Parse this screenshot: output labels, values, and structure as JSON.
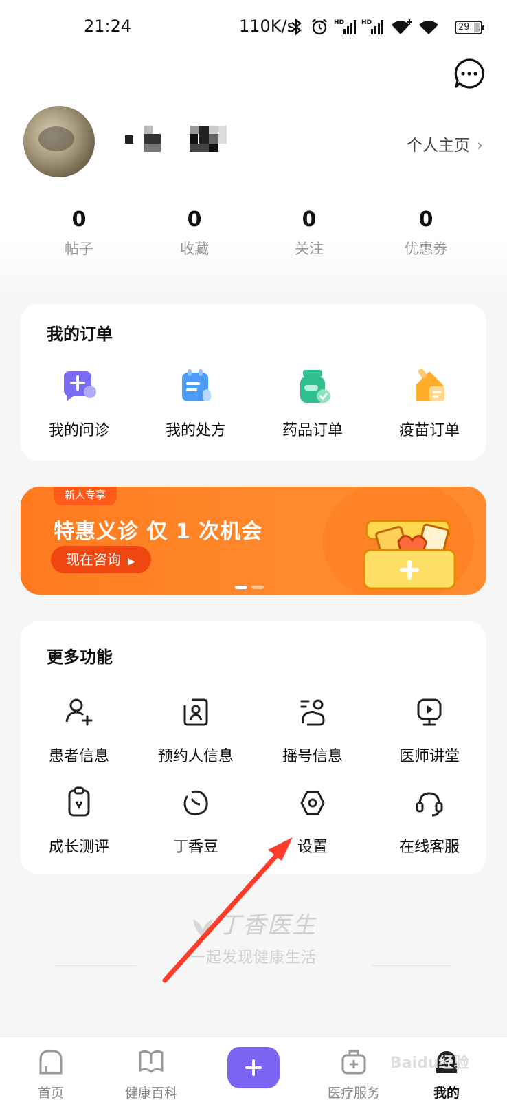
{
  "status_bar": {
    "time": "21:24",
    "speed": "110K/s",
    "battery": "29"
  },
  "profile": {
    "home_link": "个人主页",
    "stats": [
      {
        "value": "0",
        "label": "帖子"
      },
      {
        "value": "0",
        "label": "收藏"
      },
      {
        "value": "0",
        "label": "关注"
      },
      {
        "value": "0",
        "label": "优惠券"
      }
    ]
  },
  "orders": {
    "title": "我的订单",
    "items": [
      {
        "label": "我的问诊",
        "icon": "consult-icon",
        "color": "#7b6cf6"
      },
      {
        "label": "我的处方",
        "icon": "prescription-icon",
        "color": "#4d9bf8"
      },
      {
        "label": "药品订单",
        "icon": "medicine-icon",
        "color": "#2fbf8c"
      },
      {
        "label": "疫苗订单",
        "icon": "vaccine-icon",
        "color": "#ffad2a"
      }
    ]
  },
  "banner": {
    "badge": "新人专享",
    "title": "特惠义诊 仅 1 次机会",
    "cta": "现在咨询"
  },
  "more": {
    "title": "更多功能",
    "items": [
      {
        "label": "患者信息",
        "icon": "patient-info-icon"
      },
      {
        "label": "预约人信息",
        "icon": "appointment-person-icon"
      },
      {
        "label": "摇号信息",
        "icon": "lottery-info-icon"
      },
      {
        "label": "医师讲堂",
        "icon": "doctor-lecture-icon"
      },
      {
        "label": "成长测评",
        "icon": "growth-assessment-icon"
      },
      {
        "label": "丁香豆",
        "icon": "clove-bean-icon"
      },
      {
        "label": "设置",
        "icon": "settings-icon"
      },
      {
        "label": "在线客服",
        "icon": "customer-service-icon"
      }
    ]
  },
  "brand": {
    "logo": "丁香医生",
    "slogan": "一起发现健康生活"
  },
  "tabs": [
    {
      "label": "首页",
      "icon": "home-icon"
    },
    {
      "label": "健康百科",
      "icon": "encyclopedia-icon"
    },
    {
      "label": "",
      "icon": "plus-icon"
    },
    {
      "label": "医疗服务",
      "icon": "medical-service-icon"
    },
    {
      "label": "我的",
      "icon": "profile-icon"
    }
  ],
  "watermark": "Baidu经验"
}
